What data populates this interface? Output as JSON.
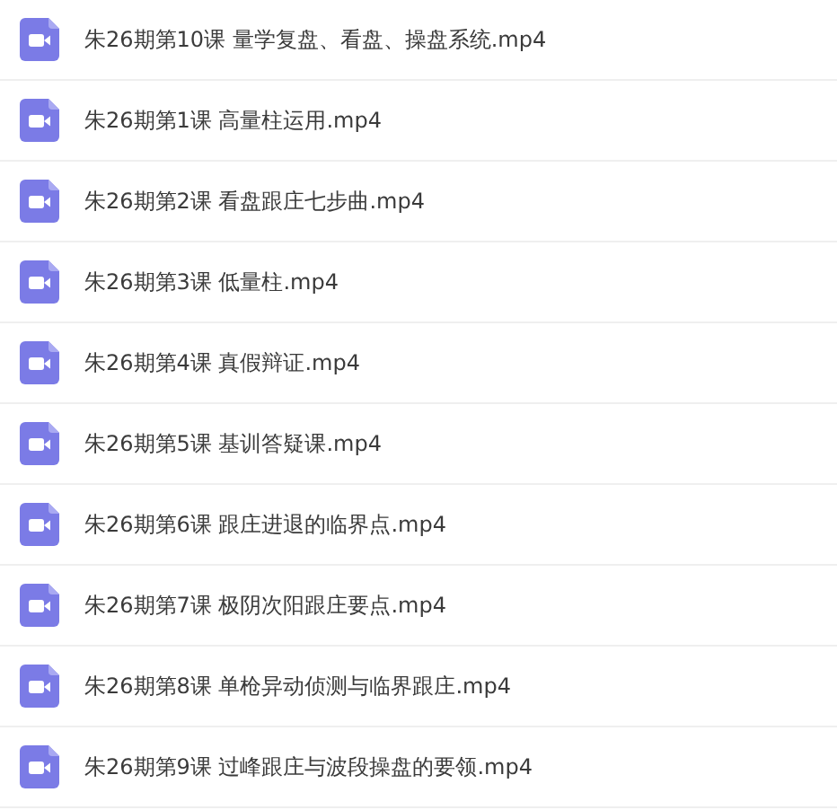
{
  "files": [
    {
      "name": "朱26期第10课 量学复盘、看盘、操盘系统.mp4"
    },
    {
      "name": "朱26期第1课 高量柱运用.mp4"
    },
    {
      "name": "朱26期第2课 看盘跟庄七步曲.mp4"
    },
    {
      "name": "朱26期第3课 低量柱.mp4"
    },
    {
      "name": "朱26期第4课 真假辩证.mp4"
    },
    {
      "name": "朱26期第5课 基训答疑课.mp4"
    },
    {
      "name": "朱26期第6课 跟庄进退的临界点.mp4"
    },
    {
      "name": "朱26期第7课 极阴次阳跟庄要点.mp4"
    },
    {
      "name": "朱26期第8课 单枪异动侦测与临界跟庄.mp4"
    },
    {
      "name": "朱26期第9课 过峰跟庄与波段操盘的要领.mp4"
    }
  ]
}
